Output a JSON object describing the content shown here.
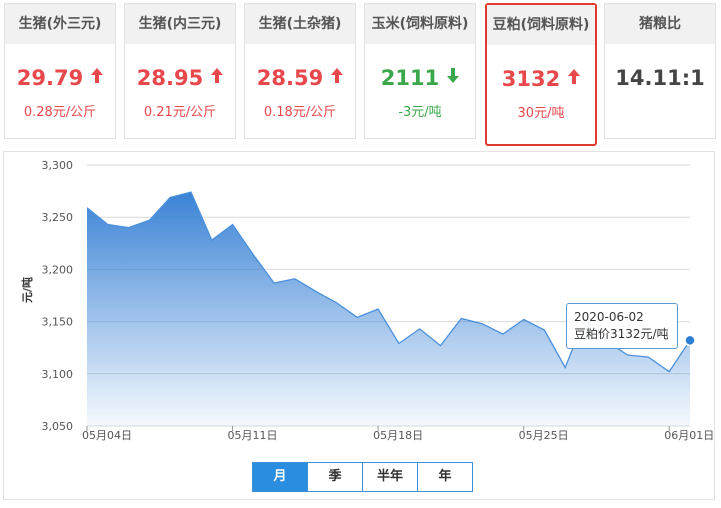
{
  "cards": [
    {
      "title": "生猪(外三元)",
      "price": "29.79",
      "change": "0.28元/公斤",
      "trend": "up"
    },
    {
      "title": "生猪(内三元)",
      "price": "28.95",
      "change": "0.21元/公斤",
      "trend": "up"
    },
    {
      "title": "生猪(土杂猪)",
      "price": "28.59",
      "change": "0.18元/公斤",
      "trend": "up"
    },
    {
      "title": "玉米(饲料原料)",
      "price": "2111",
      "change": "-3元/吨",
      "trend": "down"
    },
    {
      "title": "豆粕(饲料原料)",
      "price": "3132",
      "change": "30元/吨",
      "trend": "up"
    },
    {
      "title": "猪粮比",
      "price": "14.11:1",
      "change": "",
      "trend": "neutral"
    }
  ],
  "selected_card": 4,
  "colors": {
    "up": "#e8474b",
    "down": "#3aa84a",
    "line": "#4a90dc",
    "accent": "#2b8de0",
    "selected_border": "#e23a30"
  },
  "tabs": [
    "月",
    "季",
    "半年",
    "年"
  ],
  "active_tab": 0,
  "tooltip": {
    "date": "2020-06-02",
    "value": "豆粕价3132元/吨"
  },
  "chart_data": {
    "type": "area",
    "ylabel": "元/吨",
    "ylim": [
      3050,
      3300
    ],
    "yticks": [
      3050,
      3100,
      3150,
      3200,
      3250,
      3300
    ],
    "ytick_labels": [
      "3,050",
      "3,100",
      "3,150",
      "3,200",
      "3,250",
      "3,300"
    ],
    "grid": true,
    "x_tick_labels": [
      {
        "label": "05月04日",
        "index": 0
      },
      {
        "label": "05月11日",
        "index": 7
      },
      {
        "label": "05月18日",
        "index": 14
      },
      {
        "label": "05月25日",
        "index": 21
      },
      {
        "label": "06月01日",
        "index": 28
      }
    ],
    "dates": [
      "05-04",
      "05-05",
      "05-06",
      "05-07",
      "05-08",
      "05-09",
      "05-10",
      "05-11",
      "05-12",
      "05-13",
      "05-14",
      "05-15",
      "05-16",
      "05-17",
      "05-18",
      "05-19",
      "05-20",
      "05-21",
      "05-22",
      "05-23",
      "05-24",
      "05-25",
      "05-26",
      "05-27",
      "05-28",
      "05-29",
      "05-30",
      "05-31",
      "06-01",
      "06-02"
    ],
    "values": [
      3259,
      3243,
      3240,
      3247,
      3269,
      3274,
      3228,
      3243,
      3214,
      3187,
      3191,
      3179,
      3168,
      3154,
      3162,
      3129,
      3143,
      3127,
      3153,
      3148,
      3138,
      3152,
      3142,
      3106,
      3156,
      3131,
      3118,
      3116,
      3102,
      3132
    ],
    "highlight_index": 29
  }
}
